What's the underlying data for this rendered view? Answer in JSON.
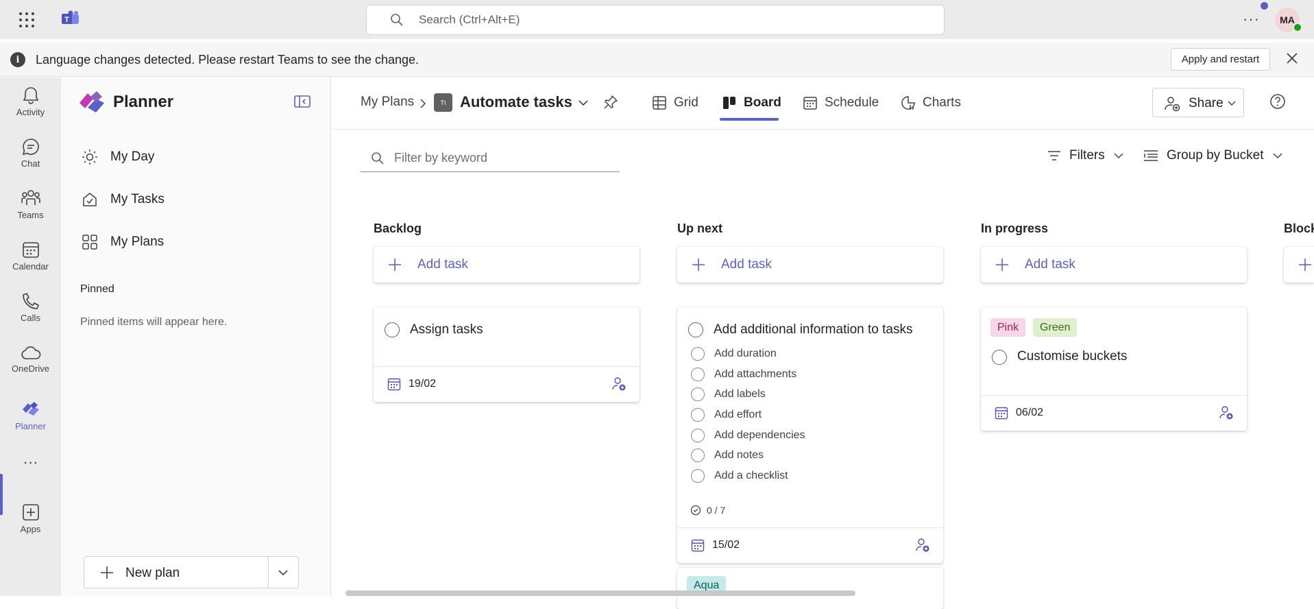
{
  "topbar": {
    "search_placeholder": "Search (Ctrl+Alt+E)",
    "more_label": "···",
    "avatar_initials": "MA"
  },
  "banner": {
    "info_label": "i",
    "message": "Language changes detected. Please restart Teams to see the change.",
    "apply_label": "Apply and restart"
  },
  "rail": {
    "items": [
      {
        "label": "Activity"
      },
      {
        "label": "Chat"
      },
      {
        "label": "Teams"
      },
      {
        "label": "Calendar"
      },
      {
        "label": "Calls"
      },
      {
        "label": "OneDrive"
      },
      {
        "label": "Planner"
      },
      {
        "label": "Apps"
      }
    ],
    "more_label": "···",
    "active": "Planner"
  },
  "sidebar": {
    "title": "Planner",
    "nav": [
      {
        "label": "My Day",
        "icon": "sun-icon"
      },
      {
        "label": "My Tasks",
        "icon": "tasks-icon"
      },
      {
        "label": "My Plans",
        "icon": "grid-icon"
      }
    ],
    "pinned_heading": "Pinned",
    "pinned_empty": "Pinned items will appear here.",
    "new_plan_label": "New plan"
  },
  "header": {
    "breadcrumb_root": "My Plans",
    "plan_badge": "TI",
    "plan_name": "Automate tasks",
    "tabs": [
      {
        "label": "Grid",
        "icon": "grid-icon"
      },
      {
        "label": "Board",
        "icon": "board-icon",
        "active": true
      },
      {
        "label": "Schedule",
        "icon": "calendar-icon"
      },
      {
        "label": "Charts",
        "icon": "chart-icon"
      }
    ],
    "share_label": "Share"
  },
  "toolbar": {
    "filter_placeholder": "Filter by keyword",
    "filters_label": "Filters",
    "groupby_label": "Group by Bucket"
  },
  "board": {
    "add_task_label": "Add task",
    "buckets": [
      {
        "title": "Backlog",
        "cards": [
          {
            "title": "Assign tasks",
            "due": "19/02"
          }
        ]
      },
      {
        "title": "Up next",
        "cards": [
          {
            "title": "Add additional information to tasks",
            "checklist": [
              "Add duration",
              "Add attachments",
              "Add labels",
              "Add effort",
              "Add dependencies",
              "Add notes",
              "Add a checklist"
            ],
            "progress": "0 / 7",
            "due": "15/02"
          },
          {
            "labels": [
              {
                "text": "Aqua",
                "color": "#c4ebe8",
                "text_color": "#0b5c57"
              }
            ]
          }
        ]
      },
      {
        "title": "In progress",
        "cards": [
          {
            "labels": [
              {
                "text": "Pink",
                "color": "#f7d7e7",
                "text_color": "#9b1d5f"
              },
              {
                "text": "Green",
                "color": "#dff0cf",
                "text_color": "#3d6b1c"
              }
            ],
            "title": "Customise buckets",
            "due": "06/02"
          }
        ]
      },
      {
        "title": "Block"
      }
    ]
  },
  "colors": {
    "accent": "#5b5fc7",
    "rail_bg": "#ebebeb",
    "sidebar_bg": "#fafafa"
  }
}
